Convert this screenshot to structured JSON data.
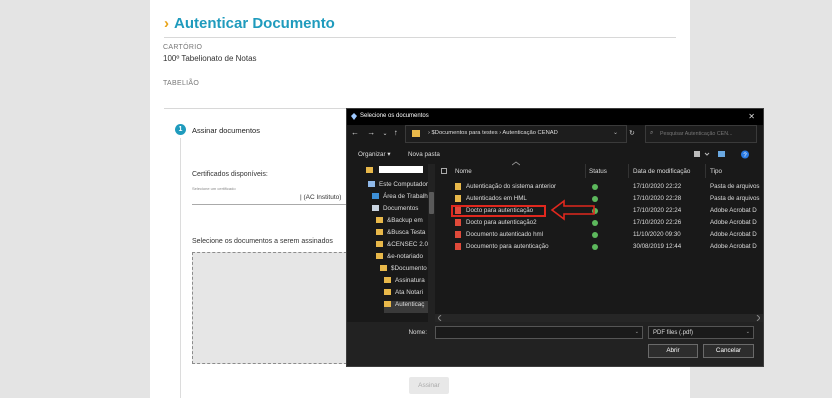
{
  "page": {
    "title_chevron": "›",
    "title": "Autenticar Documento",
    "cartorio_label": "CARTÓRIO",
    "cartorio_value": "100º Tabelionato de Notas",
    "tabeliao_label": "TABELIÃO",
    "step_number": "1",
    "step_label": "Assinar documentos",
    "certs_label": "Certificados disponíveis:",
    "certs_hint": "Selecione um certificado",
    "certs_value": "| (AC Instituto)",
    "select_docs_label": "Selecione os documentos a serem assinados",
    "assinar_button": "Assinar"
  },
  "dialog": {
    "title": "Selecione os documentos",
    "close": "✕",
    "nav": {
      "back": "←",
      "forward": "→",
      "recent": "⌄",
      "up": "↑"
    },
    "address": "›  $Documentos para testes  ›  Autenticação CENAD",
    "address_chevron": "⌄",
    "refresh": "↻",
    "search_placeholder": "Pesquisar Autenticação CEN...",
    "search_icon": "⌕",
    "organize": "Organizar ▾",
    "new_folder": "Nova pasta",
    "tree": [
      {
        "label": "",
        "icon": "folder",
        "selected": false,
        "redacted": true
      },
      {
        "label": "Este Computador",
        "icon": "computer",
        "selected": false
      },
      {
        "label": "Área de Trabalho",
        "icon": "desktop",
        "selected": false
      },
      {
        "label": "Documentos",
        "icon": "documents",
        "selected": false
      },
      {
        "label": "&Backup em",
        "icon": "folder",
        "selected": false
      },
      {
        "label": "&Busca Testa",
        "icon": "folder",
        "selected": false
      },
      {
        "label": "&CENSEC 2.0",
        "icon": "folder",
        "selected": false
      },
      {
        "label": "&e-notariado",
        "icon": "folder",
        "selected": false
      },
      {
        "label": "$Documento",
        "icon": "folder",
        "selected": false
      },
      {
        "label": "Assinatura",
        "icon": "folder",
        "selected": false
      },
      {
        "label": "Ata Notari",
        "icon": "folder",
        "selected": false
      },
      {
        "label": "Autenticaç",
        "icon": "folder",
        "selected": true
      }
    ],
    "columns": {
      "name": "Nome",
      "status": "Status",
      "date": "Data de modificação",
      "type": "Tipo"
    },
    "files": [
      {
        "name": "Autenticação do sistema anterior",
        "date": "17/10/2020 22:22",
        "type": "Pasta de arquivos",
        "kind": "folder"
      },
      {
        "name": "Autenticados em HML",
        "date": "17/10/2020 22:28",
        "type": "Pasta de arquivos",
        "kind": "folder"
      },
      {
        "name": "Docto para autenticação",
        "date": "17/10/2020 22:24",
        "type": "Adobe Acrobat D",
        "kind": "pdf"
      },
      {
        "name": "Docto para autenticação2",
        "date": "17/10/2020 22:26",
        "type": "Adobe Acrobat D",
        "kind": "pdf"
      },
      {
        "name": "Documento autenticado hml",
        "date": "11/10/2020 09:30",
        "type": "Adobe Acrobat D",
        "kind": "pdf"
      },
      {
        "name": "Documento para autenticação",
        "date": "30/08/2019 12:44",
        "type": "Adobe Acrobat D",
        "kind": "pdf"
      }
    ],
    "filename_label": "Nome:",
    "filename_value": "",
    "filter": "PDF files (.pdf)",
    "open_button": "Abrir",
    "cancel_button": "Cancelar"
  },
  "colors": {
    "accent": "#1f9bbd",
    "chevron": "#e8a317",
    "highlight": "#e0281e",
    "folder": "#e8b84a",
    "pdf": "#e04a3a",
    "status_ok": "#5cb85c"
  }
}
